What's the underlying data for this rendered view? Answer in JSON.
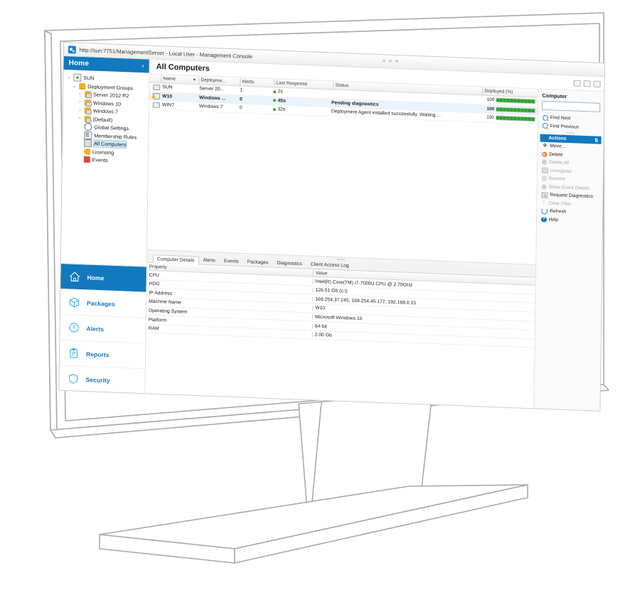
{
  "browser": {
    "url_title": "http://sun:7751/ManagementServer - Local User - Management Console",
    "icon": "app-icon"
  },
  "sidebar": {
    "header": {
      "title": "Home",
      "collapse_glyph": "‹"
    },
    "tree": [
      {
        "label": "SUN",
        "icon": "server-icon",
        "expander": "⌄",
        "indent": 0,
        "selected": false
      },
      {
        "label": "Deployment Groups",
        "icon": "folder-icon",
        "expander": "⌄",
        "indent": 1,
        "selected": false
      },
      {
        "label": "Server 2012 R2",
        "icon": "group-icon",
        "expander": "›",
        "indent": 2,
        "selected": false
      },
      {
        "label": "Windows 10",
        "icon": "group-icon",
        "expander": "›",
        "indent": 2,
        "selected": false
      },
      {
        "label": "Windows 7",
        "icon": "group-icon",
        "expander": "›",
        "indent": 2,
        "selected": false
      },
      {
        "label": "(Default)",
        "icon": "group-icon",
        "expander": "›",
        "indent": 2,
        "selected": false
      },
      {
        "label": "Global Settings",
        "icon": "gear-icon",
        "expander": "",
        "indent": 2,
        "selected": false
      },
      {
        "label": "Membership Rules",
        "icon": "rules-icon",
        "expander": "",
        "indent": 2,
        "selected": false
      },
      {
        "label": "All Computers",
        "icon": "computers-icon",
        "expander": "",
        "indent": 2,
        "selected": true
      },
      {
        "label": "Licensing",
        "icon": "key-icon",
        "expander": "",
        "indent": 2,
        "selected": false
      },
      {
        "label": "Events",
        "icon": "events-icon",
        "expander": "",
        "indent": 2,
        "selected": false
      }
    ],
    "nav": [
      {
        "label": "Home",
        "icon": "home-icon",
        "active": true
      },
      {
        "label": "Packages",
        "icon": "package-icon",
        "active": false
      },
      {
        "label": "Alerts",
        "icon": "alert-icon",
        "active": false
      },
      {
        "label": "Reports",
        "icon": "reports-icon",
        "active": false
      },
      {
        "label": "Security",
        "icon": "shield-icon",
        "active": false
      }
    ]
  },
  "main": {
    "title": "All Computers",
    "window_buttons": [
      "minimize",
      "restore",
      "close"
    ],
    "grid": {
      "columns": [
        "Name",
        "Deployme...",
        "Alerts",
        "Last Response",
        "Status",
        "Deployed (%)"
      ],
      "sort_column": "Name",
      "rows": [
        {
          "name": "SUN",
          "deployment": "Server 20...",
          "alerts": "1",
          "last_response": "2s",
          "status": "",
          "deployed": "100",
          "deployed_pct": 100,
          "icon": "monitor-icon",
          "warning": false,
          "selected": false
        },
        {
          "name": "W10",
          "deployment": "Windows ...",
          "alerts": "0",
          "last_response": "45s",
          "status": "Pending diagnostics",
          "deployed": "100",
          "deployed_pct": 100,
          "icon": "monitor-warning-icon",
          "warning": true,
          "selected": true
        },
        {
          "name": "WIN7",
          "deployment": "Windows 7",
          "alerts": "0",
          "last_response": "32s",
          "status": "Deployment Agent installed successfully. Waiting ...",
          "deployed": "100",
          "deployed_pct": 100,
          "icon": "monitor-icon",
          "warning": false,
          "selected": false
        }
      ]
    },
    "details": {
      "tabs": [
        {
          "label": "Computer Details",
          "active": true
        },
        {
          "label": "Alerts",
          "active": false
        },
        {
          "label": "Events",
          "active": false
        },
        {
          "label": "Packages",
          "active": false
        },
        {
          "label": "Diagnostics",
          "active": false
        },
        {
          "label": "Client Access Log",
          "active": false
        }
      ],
      "columns": [
        "Property",
        "Value"
      ],
      "rows": [
        {
          "property": "CPU",
          "value": "Intel(R) Core(TM) i7-7500U CPU @ 2.70GHz"
        },
        {
          "property": "HDD",
          "value": "126.51 Gb (c:\\)"
        },
        {
          "property": "IP Address",
          "value": "169.254.37.245, 169.254.45.177, 192.168.0.15"
        },
        {
          "property": "Machine Name",
          "value": "W10"
        },
        {
          "property": "Operating System",
          "value": "Microsoft Windows 10"
        },
        {
          "property": "Platform",
          "value": "64-bit"
        },
        {
          "property": "RAM",
          "value": "2.00 Gb"
        }
      ]
    }
  },
  "right_panel": {
    "title": "Computer",
    "search_value": "",
    "search_placeholder": "",
    "find": [
      {
        "label": "Find Next",
        "icon": "search-icon",
        "enabled": true
      },
      {
        "label": "Find Previous",
        "icon": "search-icon",
        "enabled": true
      }
    ],
    "actions_header": {
      "label": "Actions",
      "glyph": "⇅"
    },
    "actions": [
      {
        "label": "Move...",
        "icon": "move-icon",
        "enabled": true
      },
      {
        "label": "Delete",
        "icon": "delete-icon",
        "enabled": true
      },
      {
        "label": "Delete All",
        "icon": "delete-all-icon",
        "enabled": false
      },
      {
        "label": "Unregister",
        "icon": "unregister-icon",
        "enabled": false
      },
      {
        "label": "Restore",
        "icon": "restore-icon",
        "enabled": false
      },
      {
        "label": "Show Event Details",
        "icon": "event-details-icon",
        "enabled": false
      },
      {
        "label": "Request Diagnostics",
        "icon": "diagnostics-icon",
        "enabled": true
      },
      {
        "label": "Clear Filter",
        "icon": "filter-icon",
        "enabled": false
      },
      {
        "label": "Refresh",
        "icon": "refresh-icon",
        "enabled": true
      },
      {
        "label": "Help",
        "icon": "help-icon",
        "enabled": true
      }
    ]
  },
  "colors": {
    "accent": "#1279be",
    "progress": "#2f9e2f",
    "warning": "#f2b705",
    "danger": "#e8762c"
  }
}
